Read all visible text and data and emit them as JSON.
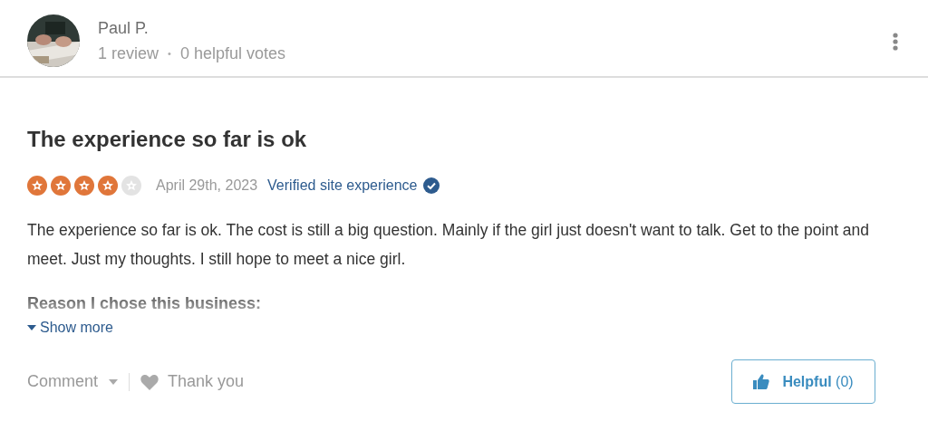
{
  "reviewer": {
    "name": "Paul P.",
    "reviews": "1 review",
    "separator": "•",
    "helpful_votes": "0 helpful votes"
  },
  "review": {
    "title": "The experience so far is ok",
    "stars": 4,
    "date": "April 29th, 2023",
    "verified": "Verified site experience",
    "body": "The experience so far is ok. The cost is still a big question. Mainly if the girl just doesn't want to talk. Get to the point and meet. Just my thoughts. I still hope to meet a nice girl.",
    "reason_heading": "Reason I chose this business:",
    "show_more": "Show more",
    "expanded": false
  },
  "actions": {
    "comment": "Comment",
    "thank_you": "Thank you",
    "helpful": "**Helpful** (0)"
  }
}
